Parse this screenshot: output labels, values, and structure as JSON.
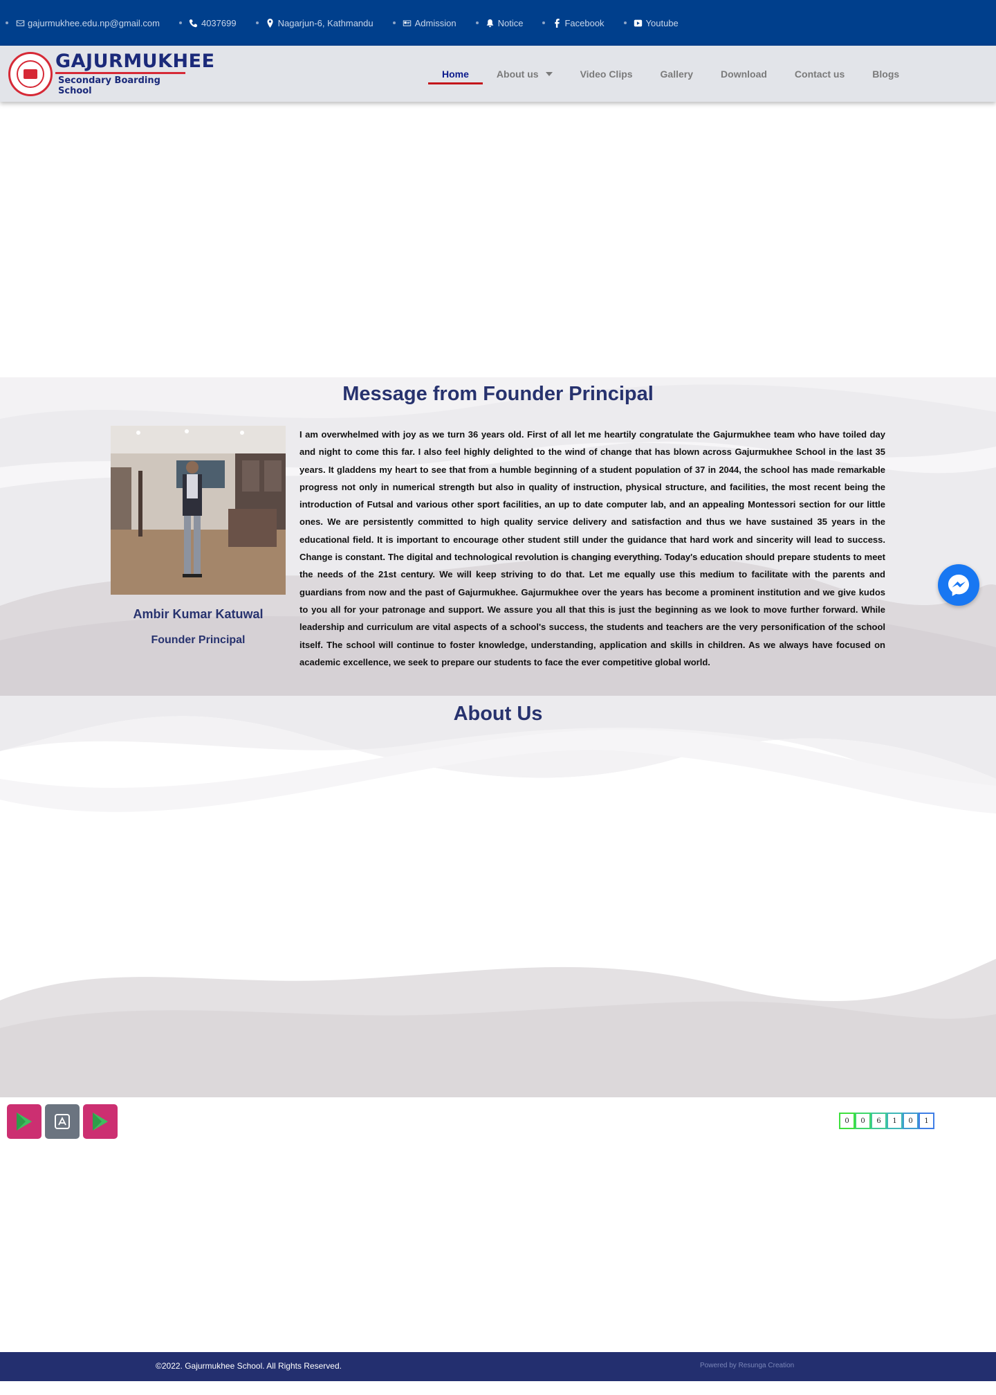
{
  "topbar": {
    "items": [
      {
        "icon": "envelope-icon",
        "label": "gajurmukhee.edu.np@gmail.com"
      },
      {
        "icon": "phone-icon",
        "label": "4037699"
      },
      {
        "icon": "map-marker-icon",
        "label": "Nagarjun-6, Kathmandu"
      },
      {
        "icon": "id-card-icon",
        "label": "Admission"
      },
      {
        "icon": "bell-icon",
        "label": "Notice"
      },
      {
        "icon": "facebook-icon",
        "label": "Facebook"
      },
      {
        "icon": "youtube-icon",
        "label": "Youtube"
      }
    ]
  },
  "header": {
    "logo_title": "GAJURMUKHEE",
    "logo_subtitle": "Secondary Boarding School",
    "nav": [
      {
        "label": "Home",
        "active": true
      },
      {
        "label": "About us",
        "has_dropdown": true
      },
      {
        "label": "Video Clips"
      },
      {
        "label": "Gallery"
      },
      {
        "label": "Download"
      },
      {
        "label": "Contact us"
      },
      {
        "label": "Blogs"
      }
    ]
  },
  "message": {
    "heading": "Message from Founder Principal",
    "name": "Ambir Kumar Katuwal",
    "role": "Founder Principal",
    "text": "I am overwhelmed with joy as we turn 36 years old. First of all let me heartily congratulate the Gajurmukhee team who have toiled day and night to come this far. I also feel highly delighted to the wind of change that has blown across Gajurmukhee School in the last 35 years. It gladdens my heart to see that from a humble beginning of a student population of 37 in 2044, the school has made remarkable progress not only in numerical strength but also in quality of instruction, physical structure, and facilities, the most recent being the introduction of Futsal and various other sport facilities, an up to date computer lab, and an appealing Montessori section for our little ones. We are persistently committed to high quality service delivery and satisfaction and thus we have sustained 35 years in the educational field. It is important to encourage other student still under the guidance that hard work and sincerity will lead to success. Change is constant. The digital and technological revolution is changing everything. Today's education should prepare students to meet the needs of the 21st century. We will keep striving to do that. Let me equally use this medium to facilitate with the parents and guardians from now and the past of Gajurmukhee. Gajurmukhee over the years has become a prominent institution and we give kudos to you all for your patronage and support. We assure you all that this is just the beginning as we look to move further forward. While leadership and curriculum are vital aspects of a school's success, the students and teachers are the very personification of the school itself. The school will continue to foster knowledge, understanding, application and skills in children. As we always have focused on academic excellence, we seek to prepare our students to face the ever competitive global world."
  },
  "about": {
    "heading": "About Us"
  },
  "visitor_counter": {
    "digits": [
      "0",
      "0",
      "6",
      "1",
      "0",
      "1"
    ]
  },
  "footer": {
    "copyright": "©2022. Gajurmukhee School. All Rights Reserved.",
    "powered": "Powered by Resunga Creation"
  },
  "colors": {
    "topbar": "#003f8c",
    "heading": "#27326e",
    "accent": "#c4161c",
    "footer": "#232f6f"
  }
}
